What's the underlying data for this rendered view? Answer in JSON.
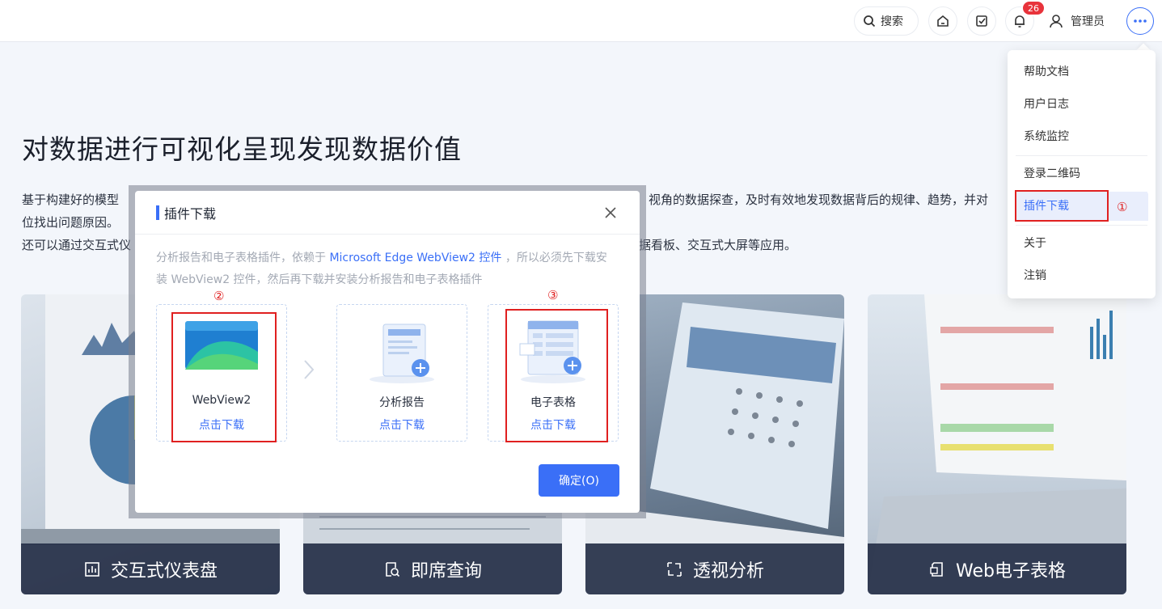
{
  "topbar": {
    "search_label": "搜索",
    "notification_count": "26",
    "user_name": "管理员"
  },
  "hero": {
    "title": "对数据进行可视化呈现发现数据价值",
    "desc_line1_left": "基于构建好的模型",
    "desc_line1_right": "视角的数据探查，及时有效地发现数据背后的规律、趋势，并对",
    "desc_line2": "位找出问题原因。",
    "desc_line3_left": "还可以通过交互式仪",
    "desc_line3_right": "据看板、交互式大屏等应用。"
  },
  "cards": [
    {
      "label": "交互式仪表盘",
      "icon": "chart-icon"
    },
    {
      "label": "即席查询",
      "icon": "query-icon"
    },
    {
      "label": "透视分析",
      "icon": "pivot-icon"
    },
    {
      "label": "Web电子表格",
      "icon": "spreadsheet-icon"
    }
  ],
  "menu": {
    "items": [
      "帮助文档",
      "用户日志",
      "系统监控",
      "登录二维码",
      "插件下载",
      "关于",
      "注销"
    ],
    "active": "插件下载"
  },
  "annotations": [
    "①",
    "②",
    "③"
  ],
  "modal": {
    "title": "插件下载",
    "note_prefix": "分析报告和电子表格插件，依赖于 ",
    "note_link": "Microsoft Edge WebView2 控件",
    "note_suffix": " ，所以必须先下载安装 WebView2 控件，然后再下载并安装分析报告和电子表格插件",
    "plugins": [
      {
        "name": "WebView2",
        "download": "点击下载"
      },
      {
        "name": "分析报告",
        "download": "点击下载"
      },
      {
        "name": "电子表格",
        "download": "点击下载"
      }
    ],
    "ok_label": "确定(O)"
  },
  "colors": {
    "accent": "#3a6ff7",
    "annotation": "#e02020",
    "badge": "#e8333b"
  }
}
